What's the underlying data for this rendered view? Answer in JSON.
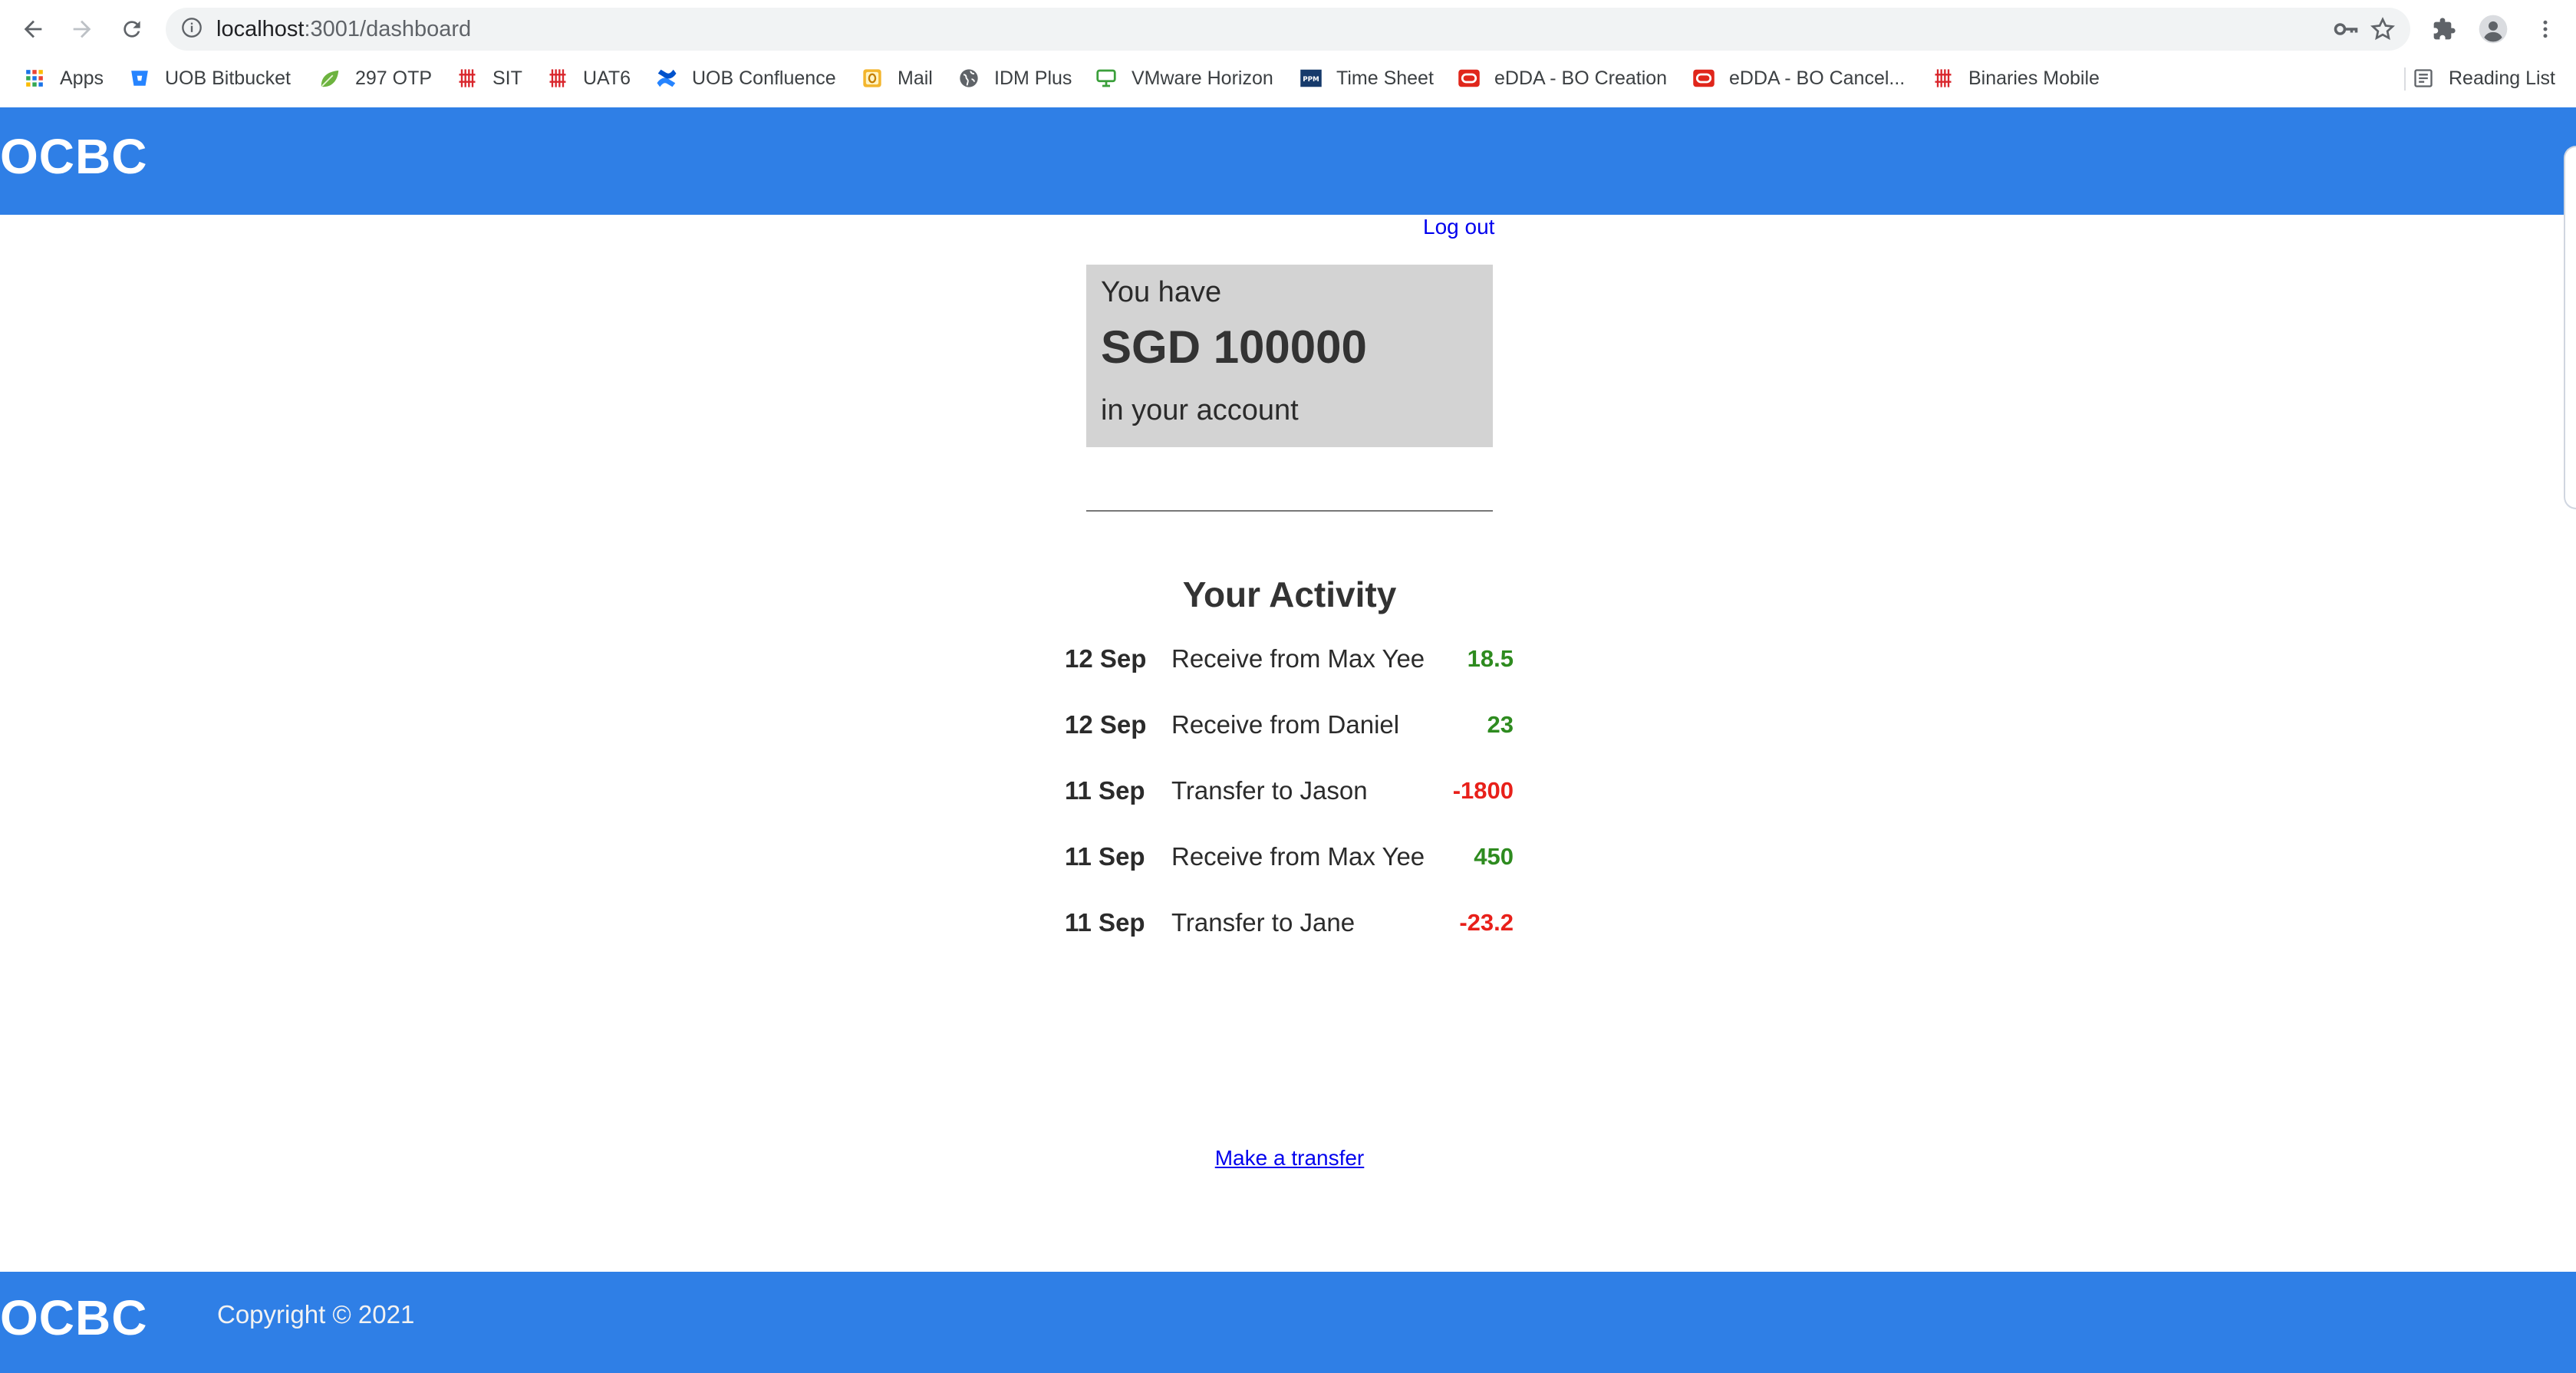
{
  "browser": {
    "url_host": "localhost",
    "url_path": ":3001/dashboard",
    "bookmarks": [
      {
        "label": "Apps",
        "icon": "apps-grid-icon"
      },
      {
        "label": "UOB Bitbucket",
        "icon": "bitbucket-icon"
      },
      {
        "label": "297 OTP",
        "icon": "leaf-icon"
      },
      {
        "label": "SIT",
        "icon": "binaries-icon"
      },
      {
        "label": "UAT6",
        "icon": "binaries-icon"
      },
      {
        "label": "UOB Confluence",
        "icon": "confluence-icon"
      },
      {
        "label": "Mail",
        "icon": "outlook-icon"
      },
      {
        "label": "IDM Plus",
        "icon": "globe-icon"
      },
      {
        "label": "VMware Horizon",
        "icon": "vmware-icon"
      },
      {
        "label": "Time Sheet",
        "icon": "ppm-icon"
      },
      {
        "label": "eDDA - BO Creation",
        "icon": "oracle-icon"
      },
      {
        "label": "eDDA - BO Cancel...",
        "icon": "oracle-icon"
      },
      {
        "label": "Binaries Mobile",
        "icon": "binaries-icon"
      }
    ],
    "reading_list": "Reading List",
    "ppm_icon_text": "PPM"
  },
  "app": {
    "brand": "OCBC",
    "logout_label": "Log out",
    "balance": {
      "line1": "You have",
      "amount": "SGD 100000",
      "line3": "in your account"
    },
    "activity_title": "Your Activity",
    "activities": [
      {
        "date": "12 Sep",
        "description": "Receive from Max Yee",
        "amount": "18.5",
        "type": "credit"
      },
      {
        "date": "12 Sep",
        "description": "Receive from Daniel",
        "amount": "23",
        "type": "credit"
      },
      {
        "date": "11 Sep",
        "description": "Transfer to Jason",
        "amount": "-1800",
        "type": "debit"
      },
      {
        "date": "11 Sep",
        "description": "Receive from Max Yee",
        "amount": "450",
        "type": "credit"
      },
      {
        "date": "11 Sep",
        "description": "Transfer to Jane",
        "amount": "-23.2",
        "type": "debit"
      }
    ],
    "transfer_label": "Make a transfer",
    "footer_brand": "OCBC",
    "copyright": "Copyright © 2021"
  },
  "colors": {
    "brand_blue": "#2f7fe6",
    "credit_green": "#2e8b1f",
    "debit_red": "#e8201a",
    "link_blue": "#0000ee",
    "balance_bg": "#d3d3d3"
  }
}
